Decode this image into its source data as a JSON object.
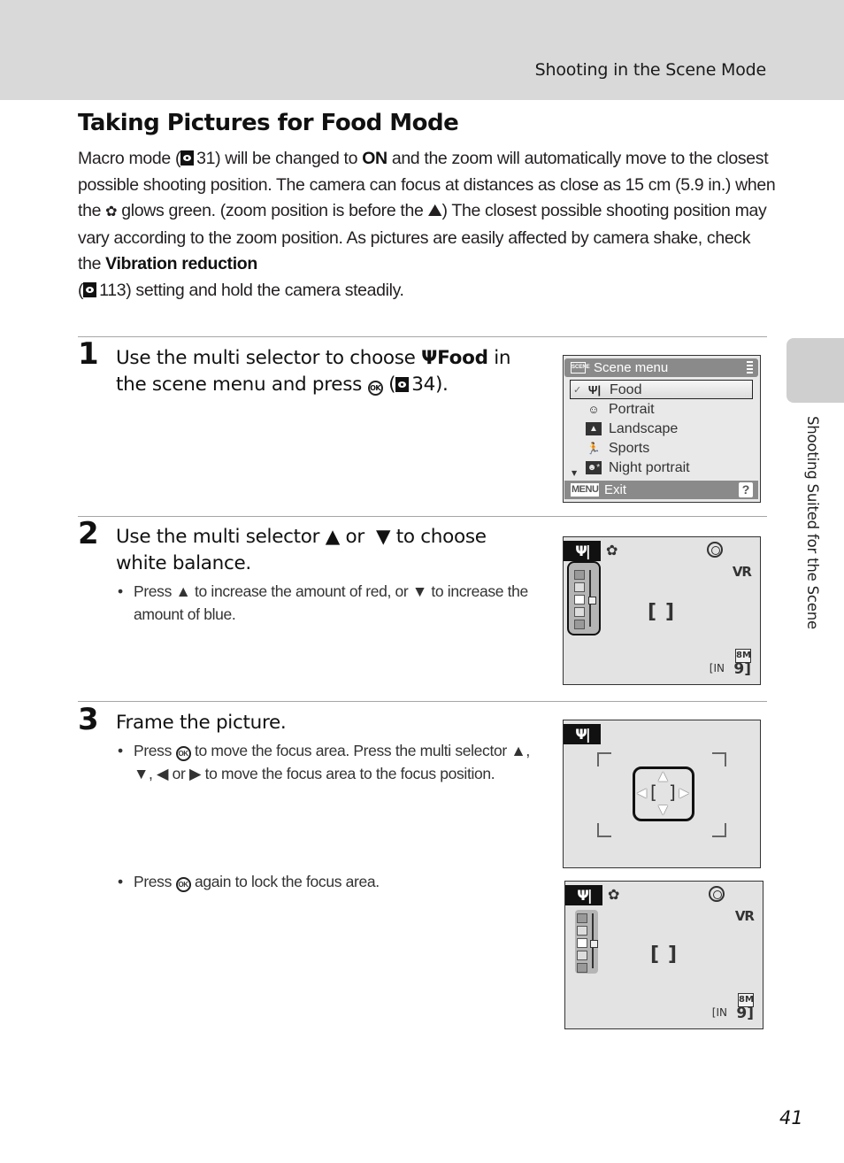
{
  "header": {
    "section_title": "Shooting in the Scene Mode"
  },
  "title": "Taking Pictures for Food Mode",
  "intro": {
    "p1a": "Macro mode (",
    "p1_ref": "31",
    "p1b": ") will be changed to ",
    "p1_bold": "ON",
    "p1c": " and the zoom will automatically move to the closest possible shooting position. The camera can focus at distances as close as 15 cm (5.9 in.) when the ",
    "p1_macro_icon": "macro-icon",
    "p1d": " glows green. (zoom position is before the ",
    "p1_wide_icon": "wide-angle-icon",
    "p1e": ") The closest possible shooting position may vary according to the zoom position. As pictures are easily affected by camera shake, check the ",
    "p1_bold2": "Vibration reduction",
    "p1f": "(",
    "p1_ref2": "113",
    "p1g": ") setting and hold the camera steadily."
  },
  "steps": [
    {
      "number": "1",
      "text_a": "Use the multi selector to choose ",
      "icon": "food-icon",
      "bold": "Food",
      "text_b": " in the scene menu and press ",
      "ok": "OK",
      "text_c": " (",
      "ref": "34",
      "text_d": ")."
    },
    {
      "number": "2",
      "text_a": "Use the multi selector ",
      "up": "▲",
      "text_b": " or  ",
      "down": "▼",
      "text_c": " to choose white balance.",
      "bullets": [
        {
          "a": "Press ",
          "up": "▲",
          "b": " to increase the amount of red, or ",
          "down": "▼",
          "c": " to increase the amount of blue."
        }
      ]
    },
    {
      "number": "3",
      "text_a": "Frame the picture.",
      "bullets": [
        {
          "a": "Press ",
          "ok": "OK",
          "b": " to move the focus area. Press the multi selector ",
          "arrows": "▲, ▼, ◀ or ▶",
          "c": " to move the focus area to the focus position."
        },
        {
          "a": "Press ",
          "ok": "OK",
          "b": " again to lock the focus area."
        }
      ]
    }
  ],
  "scene_menu": {
    "title": "Scene menu",
    "scene_badge": "SCENE",
    "items": [
      {
        "label": "Food",
        "icon": "food-icon",
        "glyph": "🍴",
        "selected": true
      },
      {
        "label": "Portrait",
        "icon": "portrait-icon",
        "glyph": "☺"
      },
      {
        "label": "Landscape",
        "icon": "landscape-icon",
        "glyph": "▲"
      },
      {
        "label": "Sports",
        "icon": "sports-icon",
        "glyph": "🏃"
      },
      {
        "label": "Night portrait",
        "icon": "night-portrait-icon",
        "glyph": "★"
      }
    ],
    "footer_menu": "MENU",
    "footer_exit": "Exit",
    "footer_help": "?"
  },
  "screens": {
    "food_tag": "Ψ|",
    "macro": "✿",
    "vr": "VR",
    "bracket_l": "[",
    "bracket_r": "]",
    "image_size": "8M",
    "memory": "[IN",
    "shots_remaining": "9]",
    "wb_levels": 5,
    "wb_selected_index": 2
  },
  "side_tab": {
    "label": "Shooting Suited for the Scene"
  },
  "page_number": "41"
}
